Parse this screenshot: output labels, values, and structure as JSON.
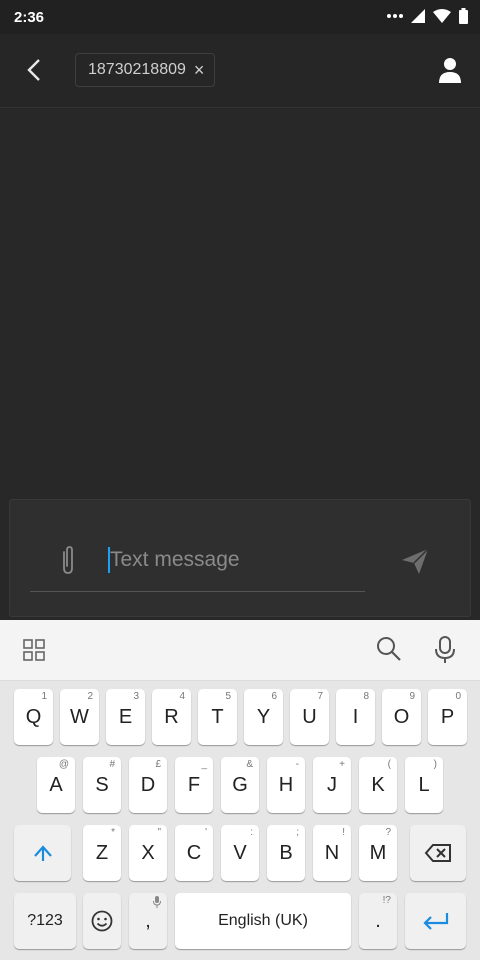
{
  "status": {
    "time": "2:36"
  },
  "header": {
    "recipient": "18730218809",
    "chip_remove": "×"
  },
  "composer": {
    "placeholder": "Text message"
  },
  "keyboard": {
    "row1": [
      {
        "k": "Q",
        "h": "1"
      },
      {
        "k": "W",
        "h": "2"
      },
      {
        "k": "E",
        "h": "3"
      },
      {
        "k": "R",
        "h": "4"
      },
      {
        "k": "T",
        "h": "5"
      },
      {
        "k": "Y",
        "h": "6"
      },
      {
        "k": "U",
        "h": "7"
      },
      {
        "k": "I",
        "h": "8"
      },
      {
        "k": "O",
        "h": "9"
      },
      {
        "k": "P",
        "h": "0"
      }
    ],
    "row2": [
      {
        "k": "A",
        "h": "@"
      },
      {
        "k": "S",
        "h": "#"
      },
      {
        "k": "D",
        "h": "£"
      },
      {
        "k": "F",
        "h": "_"
      },
      {
        "k": "G",
        "h": "&"
      },
      {
        "k": "H",
        "h": "-"
      },
      {
        "k": "J",
        "h": "+"
      },
      {
        "k": "K",
        "h": "("
      },
      {
        "k": "L",
        "h": ")"
      }
    ],
    "row3": [
      {
        "k": "Z",
        "h": "*"
      },
      {
        "k": "X",
        "h": "\""
      },
      {
        "k": "C",
        "h": "'"
      },
      {
        "k": "V",
        "h": ":"
      },
      {
        "k": "B",
        "h": ";"
      },
      {
        "k": "N",
        "h": "!"
      },
      {
        "k": "M",
        "h": "?"
      }
    ],
    "numbers_label": "?123",
    "comma": ",",
    "space_label": "English (UK)",
    "period": ".",
    "period_hint": "!?",
    "accent_color": "#1a8ce0"
  }
}
